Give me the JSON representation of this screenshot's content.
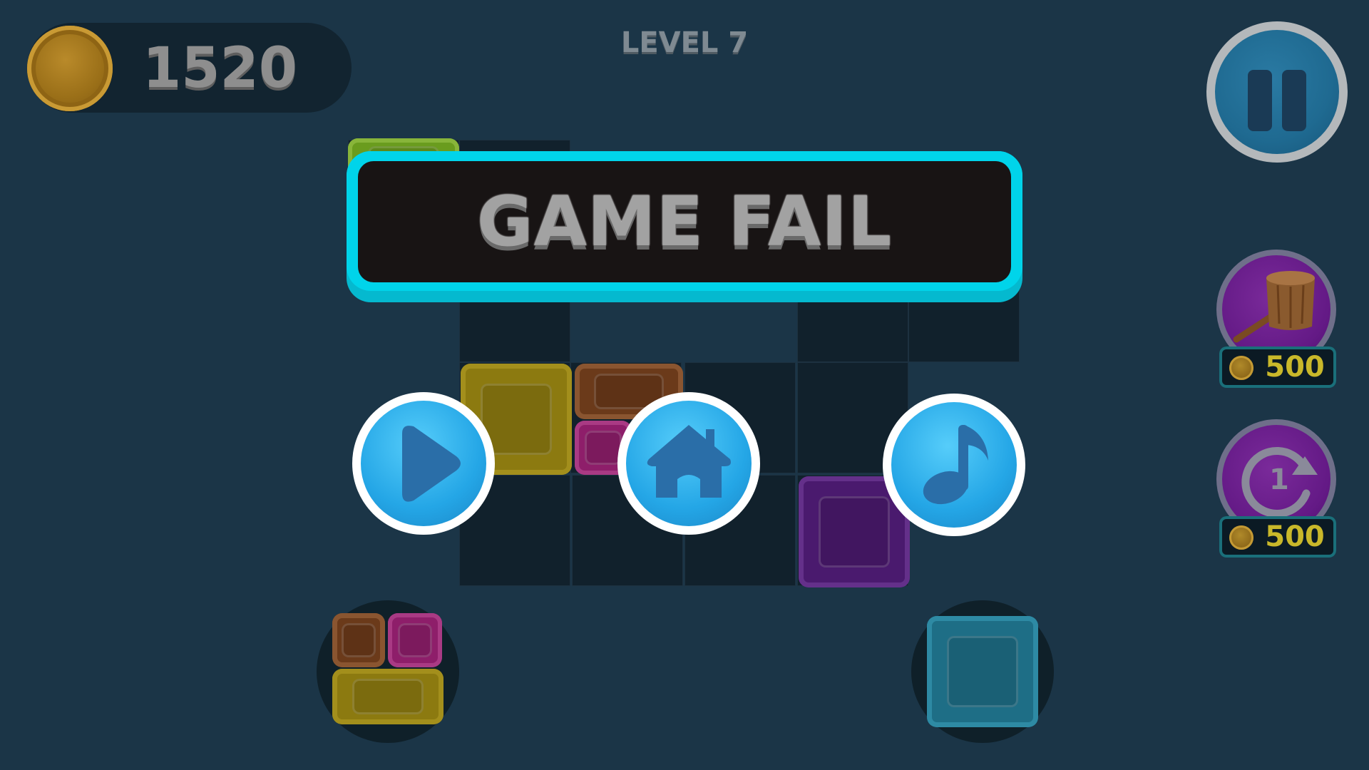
{
  "hud": {
    "coins": "1520",
    "level_label": "LEVEL 7"
  },
  "banner": {
    "title": "GAME FAIL"
  },
  "buttons": {
    "resume_icon": "play-icon",
    "home_icon": "home-icon",
    "music_icon": "music-note-icon",
    "pause_icon": "pause-icon"
  },
  "powerups": [
    {
      "name": "hammer",
      "icon": "hammer-icon",
      "price": "500"
    },
    {
      "name": "undo",
      "icon": "undo-icon",
      "label": "1",
      "price": "500"
    }
  ],
  "colors": {
    "background": "#1b3547",
    "banner_border": "#00d4ea",
    "button_blue": "#24a6e6",
    "powerup_purple": "#641a86",
    "price_text": "#c9b82a"
  }
}
